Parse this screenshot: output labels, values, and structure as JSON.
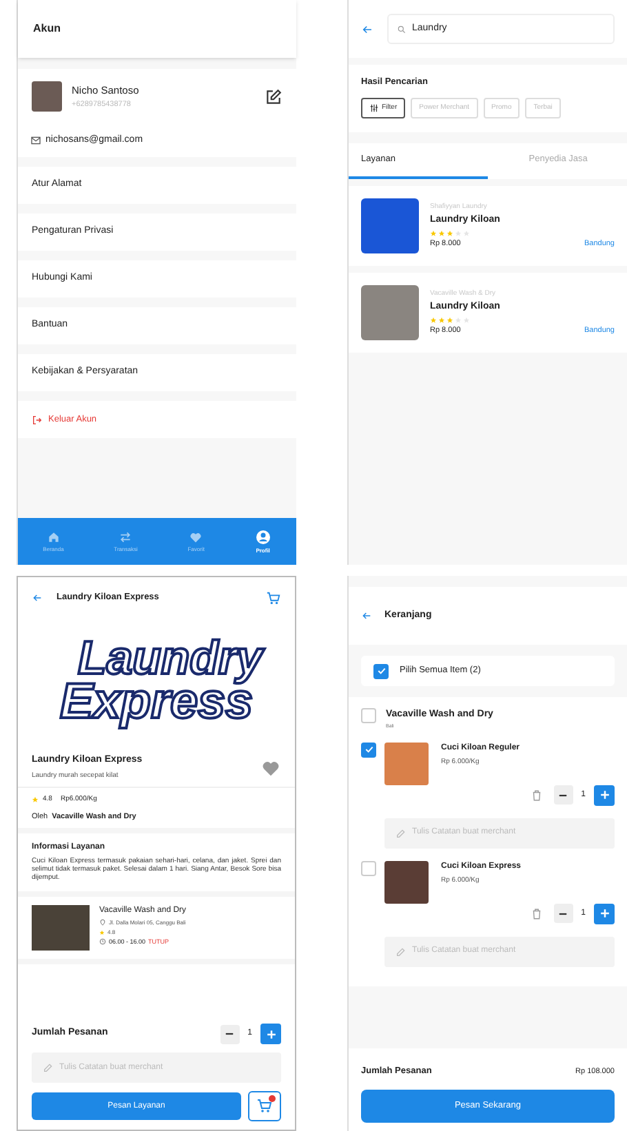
{
  "account": {
    "title": "Akun",
    "name": "Nicho Santoso",
    "phone": "+6289785438778",
    "email": "nichosans@gmail.com",
    "menu": [
      "Atur Alamat",
      "Pengaturan Privasi",
      "Hubungi Kami",
      "Bantuan",
      "Kebijakan & Persyaratan"
    ],
    "logout": "Keluar Akun",
    "nav": [
      {
        "label": "Beranda",
        "selected": false
      },
      {
        "label": "Transaksi",
        "selected": false
      },
      {
        "label": "Favorit",
        "selected": false
      },
      {
        "label": "Profil",
        "selected": true
      }
    ]
  },
  "search": {
    "query": "Laundry",
    "heading": "Hasil Pencarian",
    "chips": [
      {
        "label": "Filter",
        "kind": "filter"
      },
      {
        "label": "Power Merchant",
        "kind": "plain"
      },
      {
        "label": "Promo",
        "kind": "plain"
      },
      {
        "label": "Terbai",
        "kind": "plain"
      }
    ],
    "tabs": [
      {
        "label": "Layanan",
        "selected": true
      },
      {
        "label": "Penyedia Jasa",
        "selected": false
      }
    ],
    "results": [
      {
        "merchant": "Shafiyyan Laundry",
        "name": "Laundry Kiloan",
        "stars": 3,
        "price": "Rp 8.000",
        "city": "Bandung",
        "kind": "logo"
      },
      {
        "merchant": "Vacaville Wash & Dry",
        "name": "Laundry Kiloan",
        "stars": 3,
        "price": "Rp 8.000",
        "city": "Bandung",
        "kind": "photo"
      }
    ]
  },
  "detail": {
    "title": "Laundry Kiloan Express",
    "logo_top": "Laundry",
    "logo_bottom": "Express",
    "name": "Laundry Kiloan Express",
    "tagline": "Laundry murah secepat kilat",
    "favorite": false,
    "rating": "4.8",
    "price": "Rp6.000/Kg",
    "by_label": "Oleh",
    "by": "Vacaville Wash and Dry",
    "info_title": "Informasi Layanan",
    "info": "Cuci Kiloan Express termasuk pakaian sehari-hari, celana, dan jaket. Sprei dan selimut tidak termasuk paket. Selesai dalam 1 hari. Siang Antar, Besok Sore bisa dijemput.",
    "merchant": {
      "name": "Vacaville Wash and Dry",
      "address": "Jl. Dalla Molari 05, Canggu Bali",
      "rating": "4.8",
      "hours": "06.00 - 16.00",
      "status": "TUTUP"
    },
    "qty_label": "Jumlah Pesanan",
    "qty": "1",
    "note_placeholder": "Tulis Catatan buat merchant",
    "order": "Pesan Layanan"
  },
  "cart": {
    "title": "Keranjang",
    "select_all": {
      "label": "Pilih Semua Item (2)",
      "checked": true
    },
    "merchant": {
      "name": "Vacaville Wash and Dry",
      "sub": "Bali",
      "checked": false
    },
    "items": [
      {
        "name": "Cuci Kiloan Reguler",
        "price": "Rp 6.000/Kg",
        "checked": true,
        "qty": "1",
        "note_placeholder": "Tulis Catatan buat merchant"
      },
      {
        "name": "Cuci Kiloan Express",
        "price": "Rp 6.000/Kg",
        "checked": false,
        "qty": "1",
        "note_placeholder": "Tulis Catatan buat merchant"
      }
    ],
    "total_label": "Jumlah Pesanan",
    "total": "Rp 108.000",
    "order": "Pesan Sekarang"
  }
}
